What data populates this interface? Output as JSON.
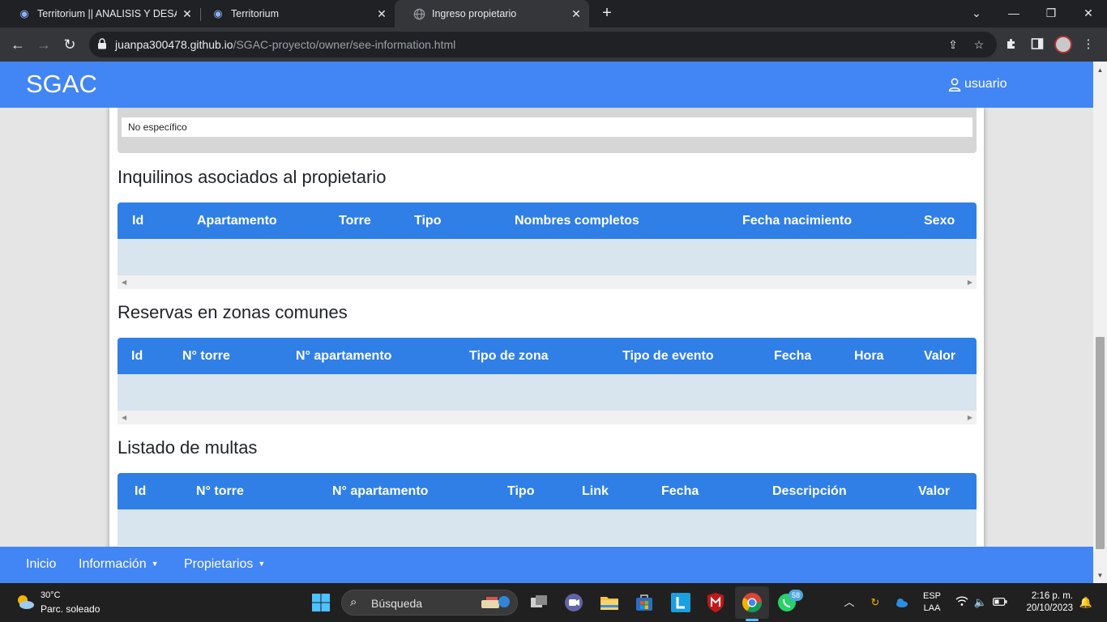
{
  "browser": {
    "tabs": [
      {
        "title": "Territorium || ANALISIS Y DESARR",
        "active": false
      },
      {
        "title": "Territorium",
        "active": false
      },
      {
        "title": "Ingreso propietario",
        "active": true
      }
    ],
    "url_host": "juanpa300478.github.io",
    "url_path": "/SGAC-proyecto/owner/see-information.html"
  },
  "app": {
    "brand": "SGAC",
    "user_label": "usuario",
    "accent_color": "#4285f4",
    "table_header_color": "#2f7fe6",
    "prev_field_value": "No específico"
  },
  "tenants": {
    "title": "Inquilinos asociados al propietario",
    "columns": [
      "Id",
      "Apartamento",
      "Torre",
      "Tipo",
      "Nombres completos",
      "Fecha nacimiento",
      "Sexo"
    ]
  },
  "reservations": {
    "title": "Reservas en zonas comunes",
    "columns": [
      "Id",
      "N° torre",
      "N° apartamento",
      "Tipo de zona",
      "Tipo de evento",
      "Fecha",
      "Hora",
      "Valor"
    ]
  },
  "fines": {
    "title": "Listado de multas",
    "columns": [
      "Id",
      "N° torre",
      "N° apartamento",
      "Tipo",
      "Link",
      "Fecha",
      "Descripción",
      "Valor"
    ]
  },
  "bottom_nav": [
    {
      "label": "Inicio",
      "has_caret": false
    },
    {
      "label": "Información",
      "has_caret": true
    },
    {
      "label": "Propietarios",
      "has_caret": true
    }
  ],
  "taskbar": {
    "temperature": "30°C",
    "weather": "Parc. soleado",
    "search_placeholder": "Búsqueda",
    "whatsapp_badge": "58",
    "lang_1": "ESP",
    "lang_2": "LAA",
    "time": "2:16 p. m.",
    "date": "20/10/2023"
  }
}
